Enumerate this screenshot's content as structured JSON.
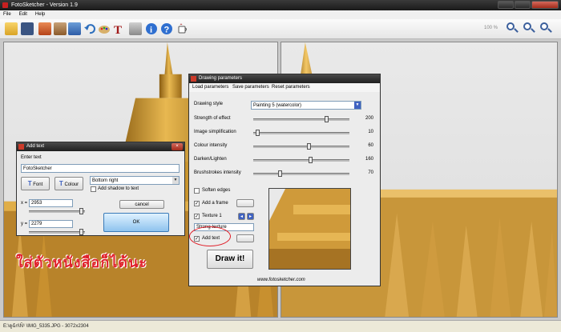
{
  "window": {
    "title": "FotoSketcher - Version 1.9"
  },
  "menu": [
    "File",
    "Edit",
    "Help"
  ],
  "toolbar": {
    "zoom": "100 %"
  },
  "status": {
    "text": "E:\\ดูฉ้ก่\\Ñ¹ \\IMG_5335.JPG - 3072x2304"
  },
  "add_text": {
    "title": "Add text",
    "enter_text_label": "Enter text",
    "text_value": "FotoSketcher",
    "font_label": "Font",
    "colour_label": "Colour",
    "position_value": "Bottom right",
    "shadow_label": "Add shadow to text",
    "x_label": "x =",
    "x_value": "2953",
    "y_label": "y =",
    "y_value": "2279",
    "cancel_label": "cancel",
    "ok_label": "OK"
  },
  "draw_params": {
    "title": "Drawing parameters",
    "menu": [
      "Load parameters",
      "Save parameters",
      "Reset parameters"
    ],
    "style_label": "Drawing style",
    "style_value": "Painting 5 (watercolor)",
    "sliders": [
      {
        "label": "Strength of effect",
        "value": "200",
        "fraction": 0.77
      },
      {
        "label": "Image simplification",
        "value": "10",
        "fraction": 0.03
      },
      {
        "label": "Colour intensity",
        "value": "60",
        "fraction": 0.58
      },
      {
        "label": "Darken/Lighten",
        "value": "160",
        "fraction": 0.6
      },
      {
        "label": "Brushstrokes intensity",
        "value": "70",
        "fraction": 0.27
      }
    ],
    "soften_label": "Soften edges",
    "frame_label": "Add a frame",
    "texture_label": "Texture 1",
    "texture_style": "Strong texture",
    "addtext_label": "Add text",
    "draw_label": "Draw it!",
    "website": "www.fotosketcher.com"
  },
  "annotation": "ใส่ตัวหนังสือก็ได้นะ",
  "colors": {
    "accent": "#3f62c1",
    "annotation": "#e0202a"
  }
}
